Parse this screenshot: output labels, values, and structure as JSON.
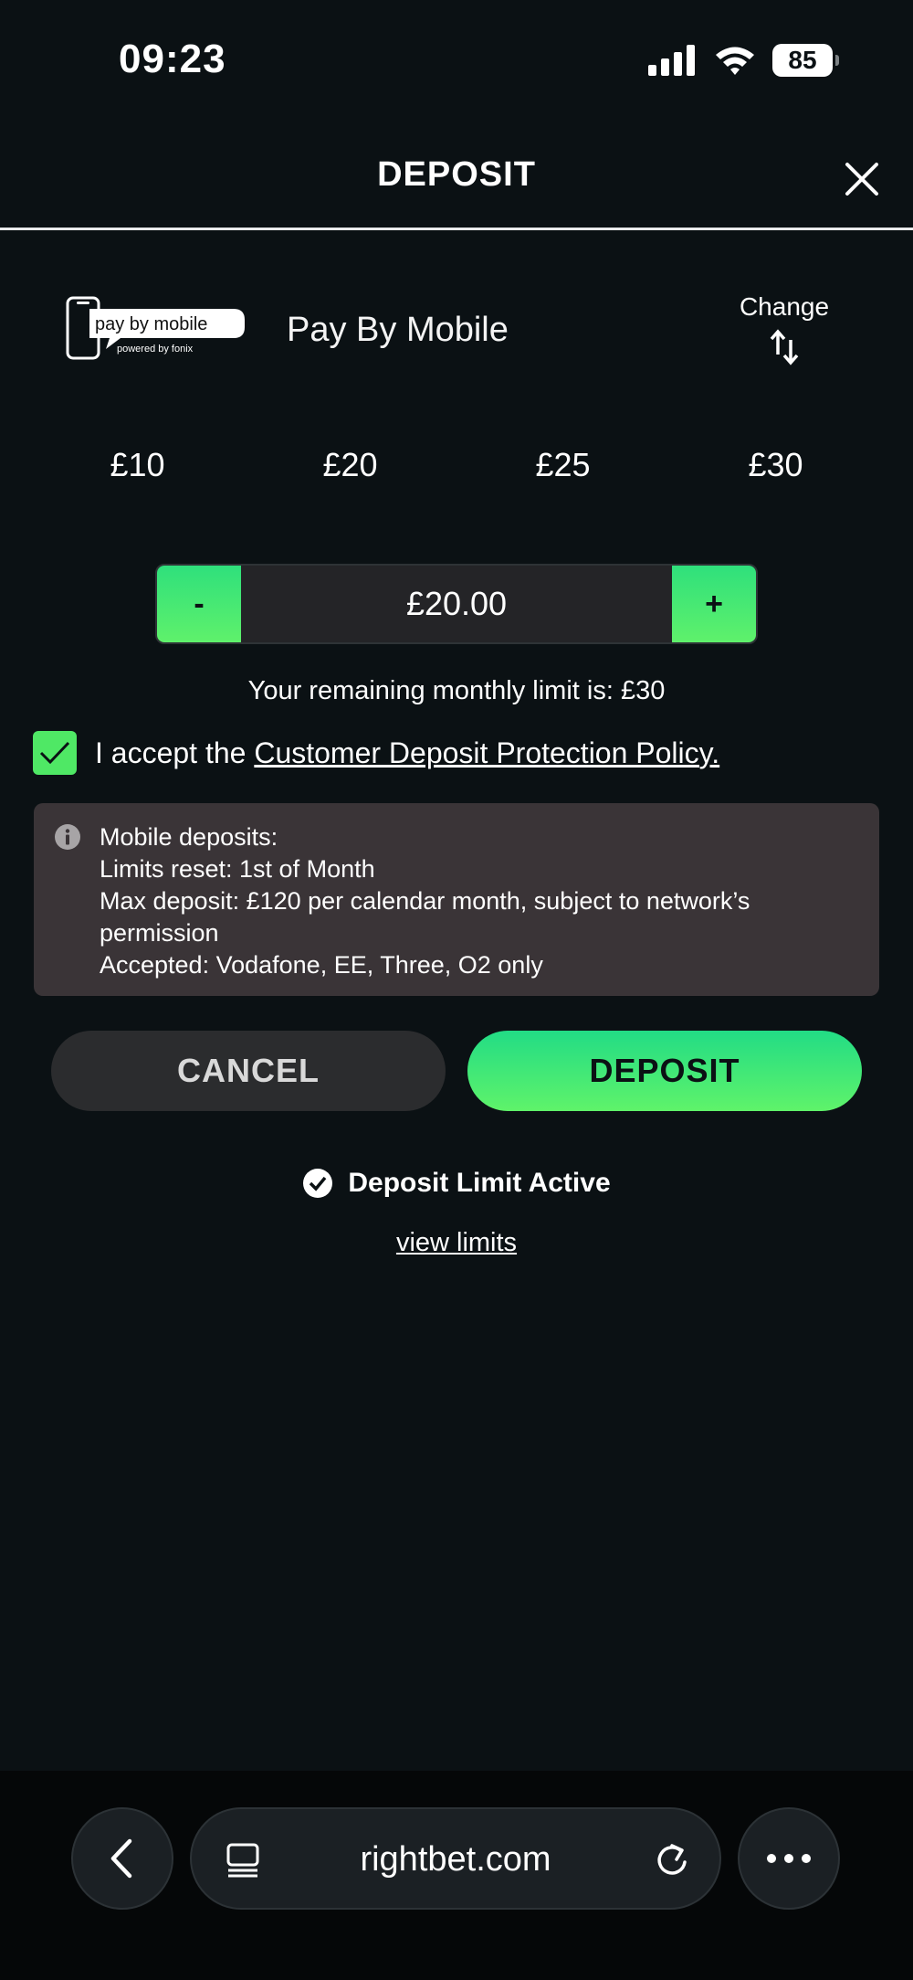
{
  "status_bar": {
    "time": "09:23",
    "battery_level": "85"
  },
  "header": {
    "title": "DEPOSIT",
    "close_icon": "close-icon"
  },
  "payment_method": {
    "logo_text": "pay by mobile",
    "logo_subtext": "powered by fonix",
    "name": "Pay By Mobile",
    "change_label": "Change"
  },
  "quick_amounts": [
    "£10",
    "£20",
    "£25",
    "£30"
  ],
  "stepper": {
    "minus_label": "-",
    "plus_label": "+",
    "value": "£20.00"
  },
  "remaining_limit_text": "Your remaining monthly limit is: £30",
  "accept": {
    "checked": true,
    "prefix": "I accept the ",
    "link_text": "Customer Deposit Protection Policy."
  },
  "info": {
    "lines": [
      "Mobile deposits:",
      "Limits reset: 1st of Month",
      "Max deposit: £120 per calendar month, subject to network’s",
      "permission",
      "Accepted: Vodafone, EE, Three, O2 only"
    ]
  },
  "buttons": {
    "cancel_label": "CANCEL",
    "deposit_label": "DEPOSIT"
  },
  "limit_status": {
    "text": "Deposit Limit Active",
    "view_limits_label": "view limits"
  },
  "browser": {
    "url": "rightbet.com"
  },
  "colors": {
    "background": "#0b1114",
    "accent_green": "#4fe865",
    "info_box": "#3a3437"
  }
}
